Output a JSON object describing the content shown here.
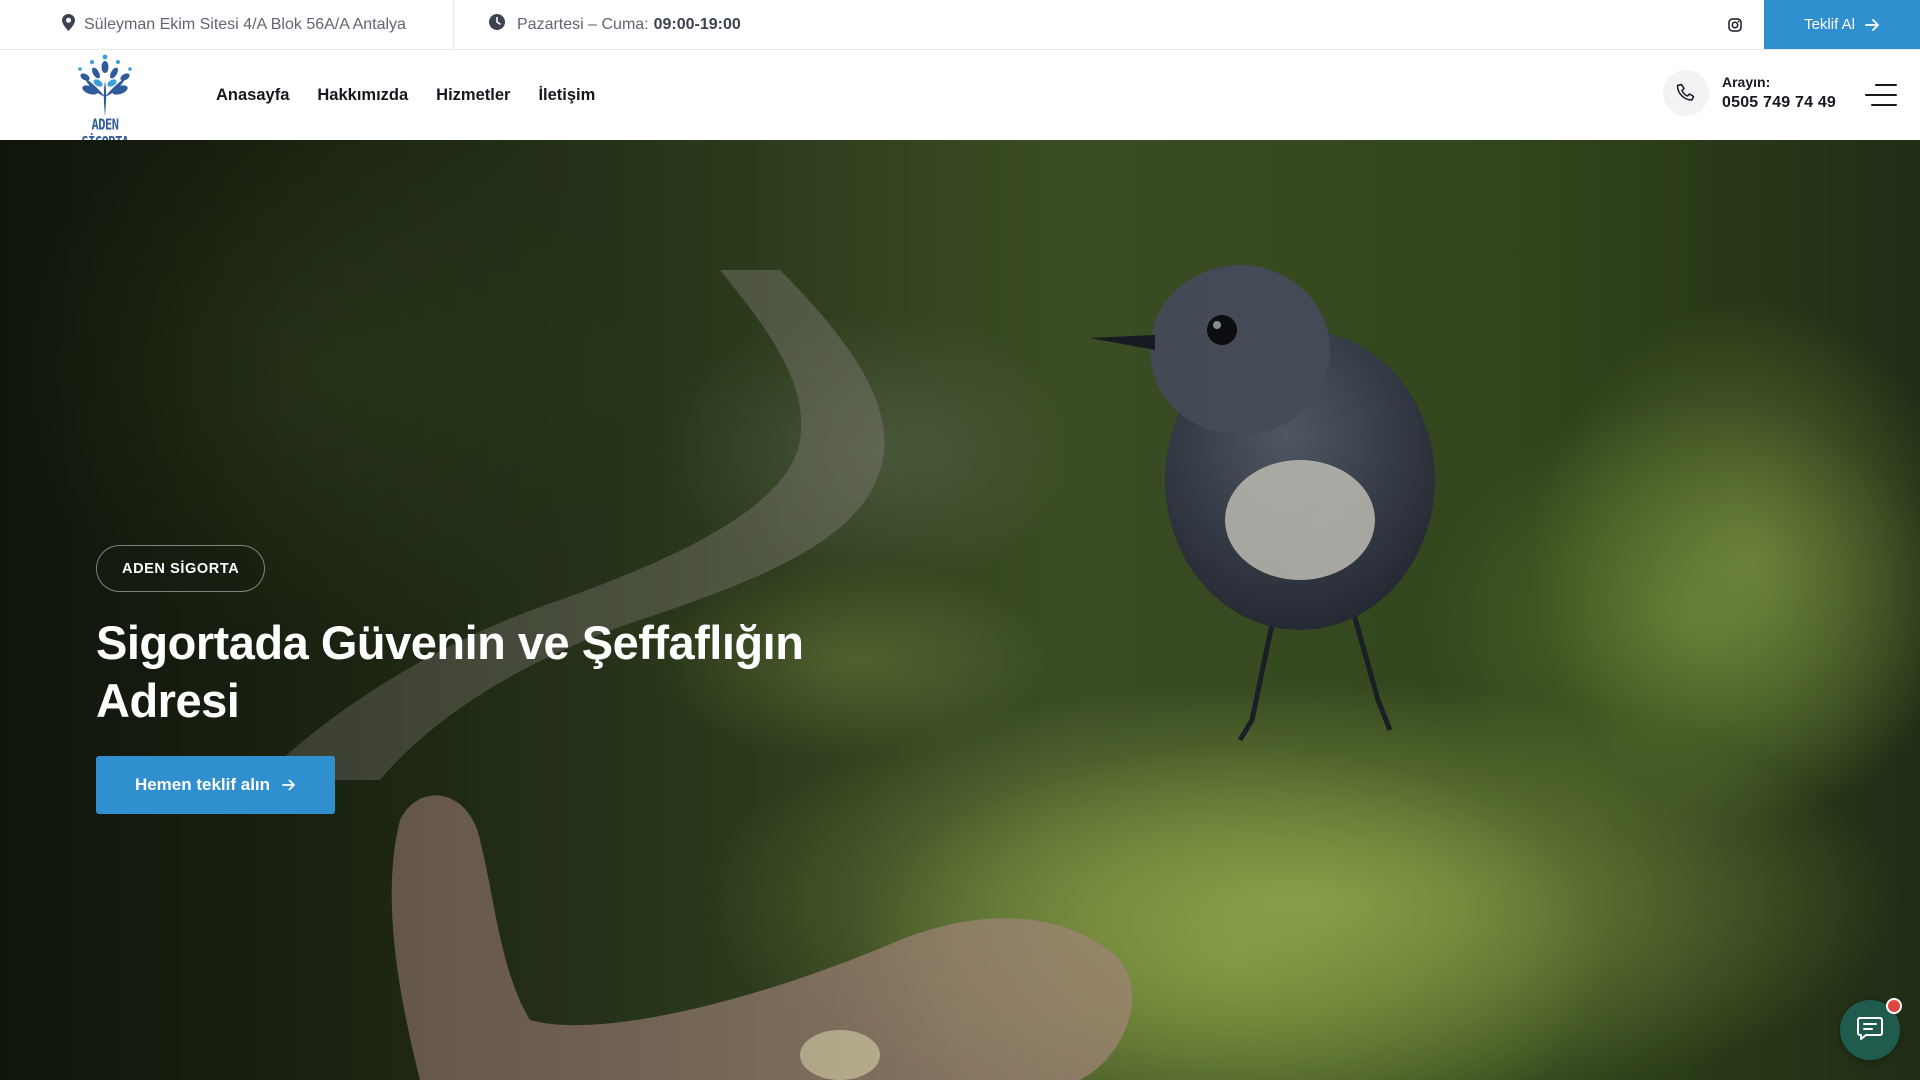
{
  "topbar": {
    "address": "Süleyman Ekim Sitesi 4/A Blok 56A/A Antalya",
    "hours_label": "Pazartesi – Cuma:",
    "hours_value": "09:00-19:00",
    "instagram_icon": "instagram-icon",
    "cta_label": "Teklif Al"
  },
  "header": {
    "logo_text": "ADEN SİGORTA",
    "nav": [
      "Anasayfa",
      "Hakkımızda",
      "Hizmetler",
      "İletişim"
    ],
    "call_label": "Arayın:",
    "call_number": "0505 749 74 49"
  },
  "hero": {
    "badge": "ADEN SİGORTA",
    "title": "Sigortada Güvenin ve Şeffaflığın Adresi",
    "button_label": "Hemen teklif alın"
  },
  "colors": {
    "accent": "#2f8fcf",
    "chat": "#1f5c4e",
    "logo": "#2f5b9a"
  }
}
